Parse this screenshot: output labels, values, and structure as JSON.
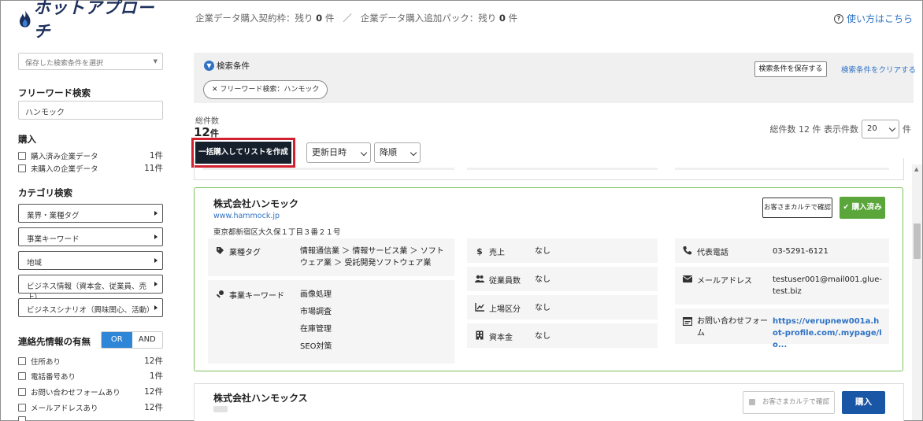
{
  "header": {
    "logo_text": "ホットアプローチ",
    "quota_contract_label": "企業データ購入契約枠：残り",
    "quota_contract_value": "0",
    "quota_contract_unit": "件",
    "quota_separator": "／",
    "quota_addon_label": "企業データ購入追加パック：残り",
    "quota_addon_value": "0",
    "quota_addon_unit": "件",
    "help_label": "使い方はこちら"
  },
  "sidebar": {
    "saved_select_placeholder": "保存した検索条件を選択",
    "freeword_heading": "フリーワード検索",
    "freeword_value": "ハンモック",
    "purchase_heading": "購入",
    "purchase_items": [
      {
        "label": "購入済み企業データ",
        "count": "1件"
      },
      {
        "label": "未購入の企業データ",
        "count": "11件"
      }
    ],
    "category_heading": "カテゴリ検索",
    "category_buttons": [
      "業界・業種タグ",
      "事業キーワード",
      "地域",
      "ビジネス情報（資本金、従業員、売上）",
      "ビジネスシナリオ（興味関心、活動）"
    ],
    "contact_heading": "連絡先情報の有無",
    "toggle_or": "OR",
    "toggle_and": "AND",
    "contact_items": [
      {
        "label": "住所あり",
        "count": "12件"
      },
      {
        "label": "電話番号あり",
        "count": "1件"
      },
      {
        "label": "お問い合わせフォームあり",
        "count": "12件"
      },
      {
        "label": "メールアドレスあり",
        "count": "12件"
      }
    ]
  },
  "conditions": {
    "title": "検索条件",
    "save_button": "検索条件を保存する",
    "clear_link": "検索条件をクリアする",
    "chip_label": "フリーワード検索：ハンモック"
  },
  "results": {
    "total_label": "総件数",
    "total_value": "12",
    "total_unit": "件",
    "bulk_button": "一括購入してリストを作成",
    "sort_field": "更新日時",
    "sort_order": "降順",
    "per_page_prefix": "総件数 12 件 表示件数",
    "per_page_value": "20",
    "per_page_suffix": "件"
  },
  "card1": {
    "name": "株式会社ハンモック",
    "url": "www.hammock.jp",
    "address": "東京都新宿区大久保１丁目３番２１号",
    "karte_button": "お客さまカルテで確認",
    "bought_label": "購入済み",
    "industry_label": "業種タグ",
    "industry_value": "情報通信業 ＞ 情報サービス業 ＞ ソフトウェア業 ＞ 受託開発ソフトウェア業",
    "keyword_label": "事業キーワード",
    "keywords": [
      "画像処理",
      "市場調査",
      "在庫管理",
      "SEO対策"
    ],
    "sales_label": "売上",
    "sales_value": "なし",
    "employees_label": "従業員数",
    "employees_value": "なし",
    "listing_label": "上場区分",
    "listing_value": "なし",
    "capital_label": "資本金",
    "capital_value": "なし",
    "phone_label": "代表電話",
    "phone_value": "03-5291-6121",
    "email_label": "メールアドレス",
    "email_value": "testuser001@mail001.glue-test.biz",
    "form_label": "お問い合わせフォーム",
    "form_value": "https://verupnew001a.hot-profile.com/.mypage/lo..."
  },
  "card2": {
    "name": "株式会社ハンモックス",
    "karte_button": "お客さまカルテで確認",
    "buy_button": "購入"
  },
  "colors": {
    "brand_navy": "#1d2f5c",
    "link_blue": "#2f72c4",
    "bought_green": "#5aa63a",
    "buy_blue": "#1a56a6",
    "highlight_red": "#d1202f"
  }
}
